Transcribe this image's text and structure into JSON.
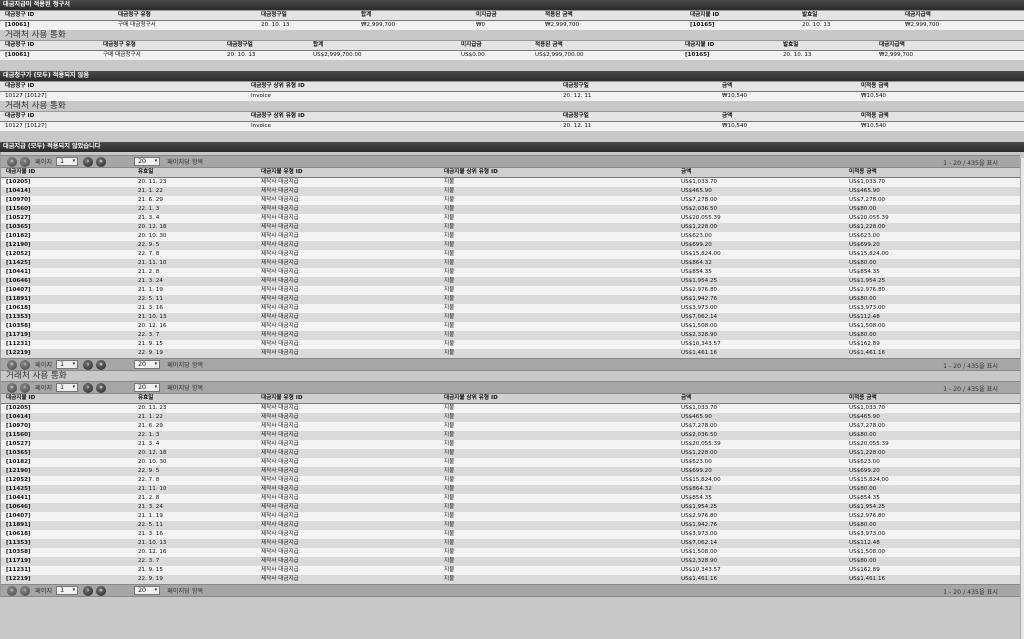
{
  "sec1": {
    "title": "대금지급미 적용된 청구서",
    "headers": [
      "대금청구 ID",
      "대금청구 유형",
      "대금청구일",
      "합계",
      "미지급금",
      "적용된 금액",
      "대금지불 ID",
      "발효일",
      "대금지급액"
    ],
    "row": [
      "[10061]",
      "구매 대금청구서",
      "20. 10. 13",
      "₩2,999,700",
      "₩0",
      "₩2,999,700",
      "[10165]",
      "20. 10. 13",
      "₩2,999,700"
    ],
    "sub_title": "거래처 사용 통화",
    "headers2": [
      "대금청구 ID",
      "대금청구 유형",
      "대금청구일",
      "합계",
      "미지급금",
      "적용된 금액",
      "대금지불 ID",
      "발효일",
      "대금지급액"
    ],
    "row2": [
      "[10061]",
      "구매 대금청구서",
      "20. 10. 13",
      "US$2,999,700.00",
      "US$0.00",
      "US$2,999,700.00",
      "[10165]",
      "20. 10. 13",
      "₩2,999,700"
    ]
  },
  "sec2": {
    "title": "대금청구가 (모두) 적용되지 않음",
    "headers": [
      "대금청구 ID",
      "대금청구 상위 유형 ID",
      "대금청구일",
      "금액",
      "미적용 금액"
    ],
    "row": [
      "10127 [10127]",
      "Invoice",
      "20. 12. 11",
      "₩10,540",
      "₩10,540"
    ],
    "sub_title": "거래처 사용 통화",
    "row2": [
      "10127 [10127]",
      "Invoice",
      "20. 12. 11",
      "₩10,540",
      "₩10,540"
    ]
  },
  "sec3": {
    "title": "대금지급 (모두) 적용되지 않았습니다",
    "pager": {
      "page_label": "페이지",
      "page": "1",
      "per_page": "20",
      "per_page_label": "페이지당 항목",
      "info": "1 - 20 / 435을 표시"
    },
    "headers": [
      "대금지불 ID",
      "유효일",
      "대금지불 유형 ID",
      "대금지불 상위 유형 ID",
      "금액",
      "미적용 금액"
    ],
    "rows": [
      [
        "[10205]",
        "20. 11. 23",
        "제작사 대금지급",
        "지불",
        "US$1,033.70",
        "US$1,033.70"
      ],
      [
        "[10414]",
        "21. 1. 22",
        "제작사 대금지급",
        "지불",
        "US$465.90",
        "US$465.90"
      ],
      [
        "[10970]",
        "21. 6. 29",
        "제작사 대금지급",
        "지불",
        "US$7,278.00",
        "US$7,278.00"
      ],
      [
        "[11560]",
        "22. 1. 3",
        "제작사 대금지급",
        "지불",
        "US$2,036.50",
        "US$80.00"
      ],
      [
        "[10527]",
        "21. 3. 4",
        "제작사 대금지급",
        "지불",
        "US$20,055.39",
        "US$20,055.39"
      ],
      [
        "[10365]",
        "20. 12. 18",
        "제작사 대금지급",
        "지불",
        "US$1,228.00",
        "US$1,228.00"
      ],
      [
        "[10182]",
        "20. 10. 30",
        "제작사 대금지급",
        "지불",
        "US$623.00",
        "US$623.00"
      ],
      [
        "[12190]",
        "22. 9. 5",
        "제작사 대금지급",
        "지불",
        "US$699.20",
        "US$699.20"
      ],
      [
        "[12052]",
        "22. 7. 8",
        "제작사 대금지급",
        "지불",
        "US$15,824.00",
        "US$15,824.00"
      ],
      [
        "[11425]",
        "21. 11. 10",
        "제작사 대금지급",
        "지불",
        "US$864.32",
        "US$80.00"
      ],
      [
        "[10441]",
        "21. 2. 8",
        "제작사 대금지급",
        "지불",
        "US$854.35",
        "US$854.35"
      ],
      [
        "[10646]",
        "21. 3. 24",
        "제작사 대금지급",
        "지불",
        "US$1,954.25",
        "US$1,954.25"
      ],
      [
        "[10407]",
        "21. 1. 19",
        "제작사 대금지급",
        "지불",
        "US$2,976.80",
        "US$2,976.80"
      ],
      [
        "[11891]",
        "22. 5. 11",
        "제작사 대금지급",
        "지불",
        "US$1,942.76",
        "US$80.00"
      ],
      [
        "[10618]",
        "21. 3. 16",
        "제작사 대금지급",
        "지불",
        "US$3,973.00",
        "US$3,973.00"
      ],
      [
        "[11353]",
        "21. 10. 13",
        "제작사 대금지급",
        "지불",
        "US$7,062.14",
        "US$112.48"
      ],
      [
        "[10358]",
        "20. 12. 16",
        "제작사 대금지급",
        "지불",
        "US$1,508.00",
        "US$1,508.00"
      ],
      [
        "[11719]",
        "22. 3. 7",
        "제작사 대금지급",
        "지불",
        "US$2,328.90",
        "US$80.00"
      ],
      [
        "[11231]",
        "21. 9. 15",
        "제작사 대금지급",
        "지불",
        "US$10,343.57",
        "US$162.89"
      ],
      [
        "[12219]",
        "22. 9. 19",
        "제작사 대금지급",
        "지불",
        "US$1,461.16",
        "US$1,461.16"
      ]
    ],
    "sub_title": "거래처 사용 통화"
  }
}
